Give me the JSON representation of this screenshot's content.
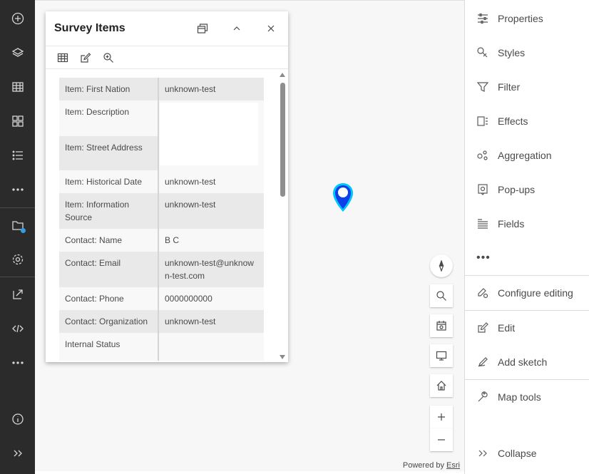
{
  "attribution": {
    "prefix": "Powered by ",
    "link": "Esri"
  },
  "popup": {
    "title": "Survey Items",
    "rows": [
      {
        "key": "Item: First Nation",
        "value": "unknown-test"
      },
      {
        "key": "Item: Description",
        "value": ""
      },
      {
        "key": "Item: Street Address",
        "value": ""
      },
      {
        "key": "Item: Historical Date",
        "value": "unknown-test"
      },
      {
        "key": "Item: Information Source",
        "value": "unknown-test"
      },
      {
        "key": "Contact: Name",
        "value": "B C"
      },
      {
        "key": "Contact: Email",
        "value": "unknown-test@unknown-test.com"
      },
      {
        "key": "Contact: Phone",
        "value": "0000000000"
      },
      {
        "key": "Contact: Organization",
        "value": "unknown-test"
      },
      {
        "key": "Internal Status",
        "value": ""
      }
    ]
  },
  "right_panel": {
    "properties": "Properties",
    "styles": "Styles",
    "filter": "Filter",
    "effects": "Effects",
    "aggregation": "Aggregation",
    "popups": "Pop-ups",
    "fields": "Fields",
    "more": "•••",
    "configure_editing": "Configure editing",
    "edit": "Edit",
    "add_sketch": "Add sketch",
    "map_tools": "Map tools",
    "collapse": "Collapse"
  },
  "colors": {
    "accent": "#0f3fe8",
    "pin_outline": "#00c5ff",
    "leftbar": "#2b2b2b",
    "badge": "#2f9ee6"
  }
}
